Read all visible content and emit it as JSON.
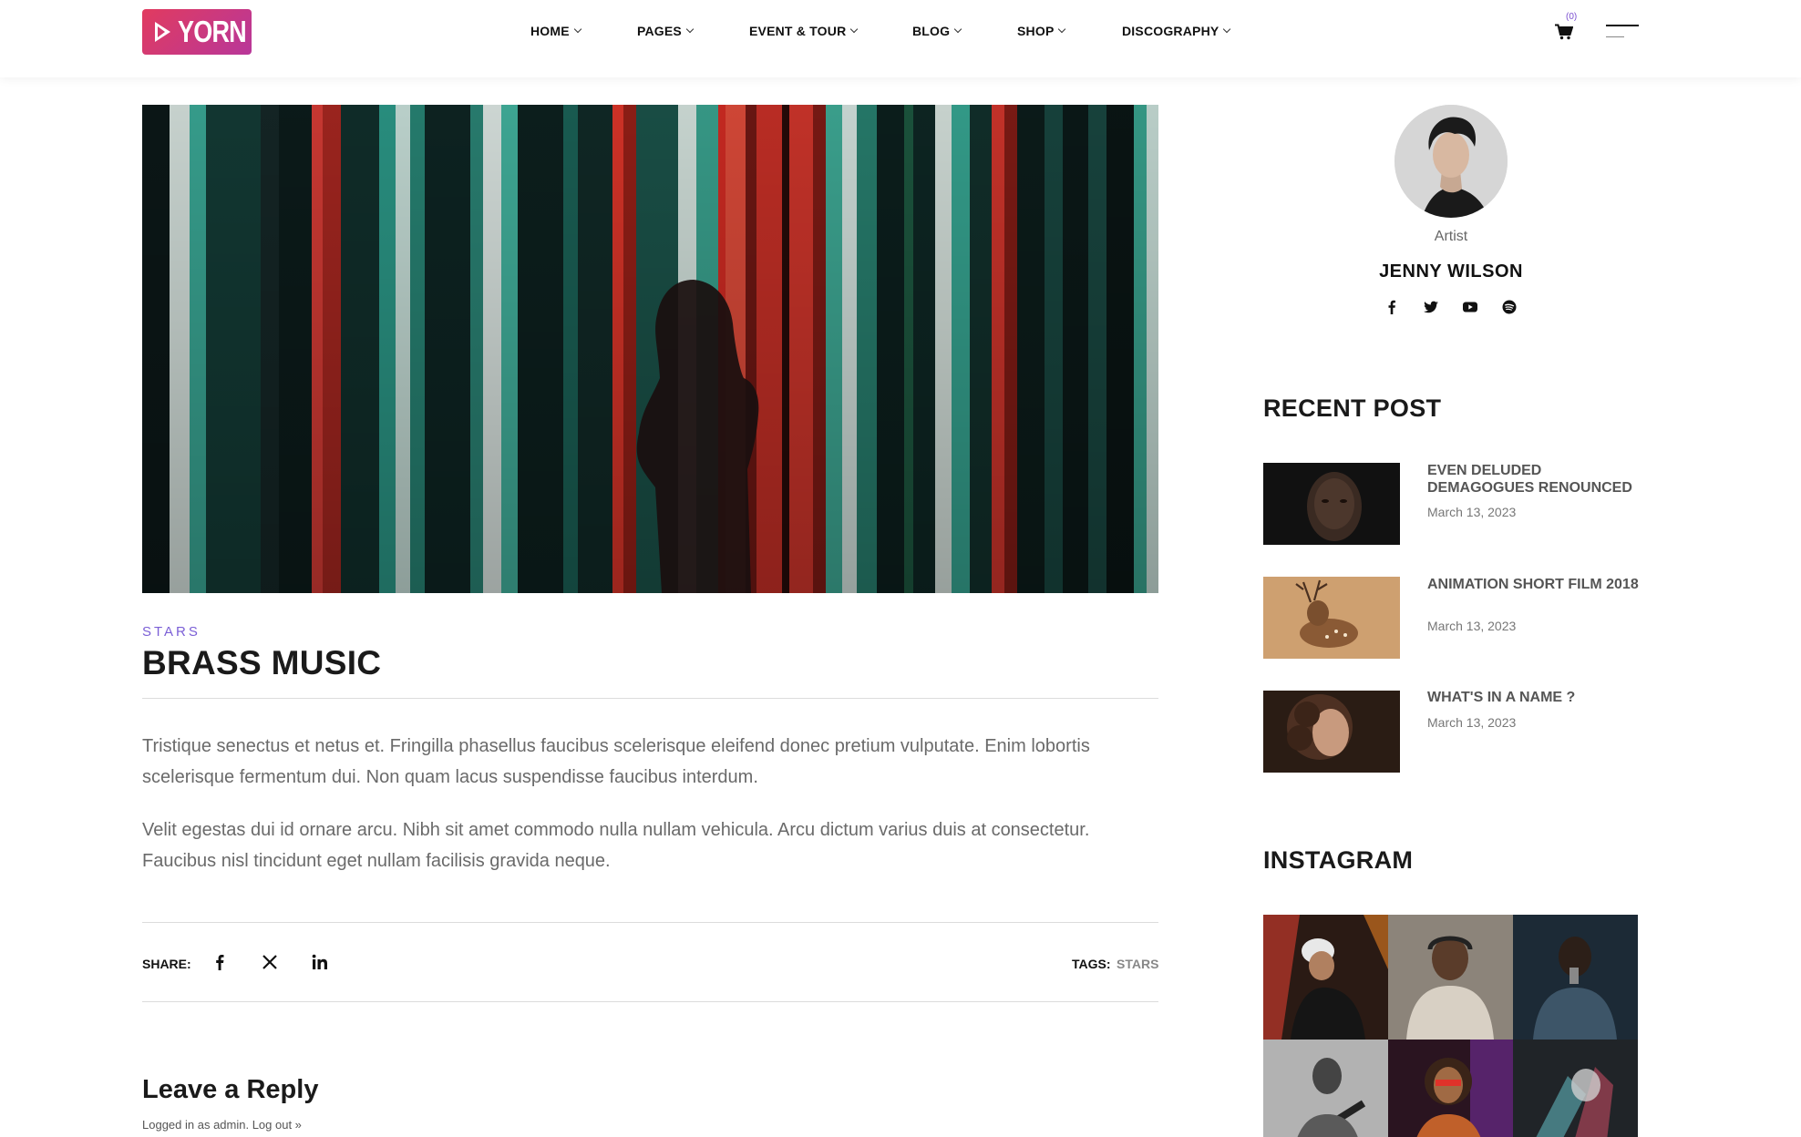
{
  "header": {
    "logo_text": "YORN",
    "cart_count": "(0)",
    "nav": [
      {
        "label": "HOME"
      },
      {
        "label": "PAGES"
      },
      {
        "label": "EVENT & TOUR"
      },
      {
        "label": "BLOG"
      },
      {
        "label": "SHOP"
      },
      {
        "label": "DISCOGRAPHY"
      }
    ]
  },
  "article": {
    "category": "STARS",
    "title": "BRASS MUSIC",
    "paragraphs": [
      "Tristique senectus et netus et. Fringilla phasellus faucibus scelerisque eleifend donec pretium vulputate. Enim lobortis scelerisque fermentum dui. Non quam lacus suspendisse faucibus interdum.",
      "Velit egestas dui id ornare arcu. Nibh sit amet commodo nulla nullam vehicula. Arcu dictum varius duis at consectetur. Faucibus nisl tincidunt eget nullam facilisis gravida neque."
    ],
    "share_label": "SHARE:",
    "tags_label": "TAGS:",
    "tags_value": "STARS"
  },
  "reply": {
    "title": "Leave a Reply",
    "logged_in": "Logged in as admin. Log out »"
  },
  "sidebar": {
    "artist_role": "Artist",
    "artist_name": "JENNY WILSON",
    "social_icons": [
      "facebook-icon",
      "twitter-icon",
      "youtube-icon",
      "spotify-icon"
    ],
    "recent_title": "RECENT POST",
    "posts": [
      {
        "title": "EVEN DELUDED DEMAGOGUES RENOUNCED",
        "date": "March 13, 2023"
      },
      {
        "title": "ANIMATION SHORT FILM 2018",
        "date": "March 13, 2023"
      },
      {
        "title": "WHAT'S IN A NAME ?",
        "date": "March 13, 2023"
      }
    ],
    "instagram_title": "INSTAGRAM"
  },
  "colors": {
    "accent": "#7b5fd6",
    "logo_gradient_start": "#e13b5f",
    "logo_gradient_end": "#b8379a"
  }
}
